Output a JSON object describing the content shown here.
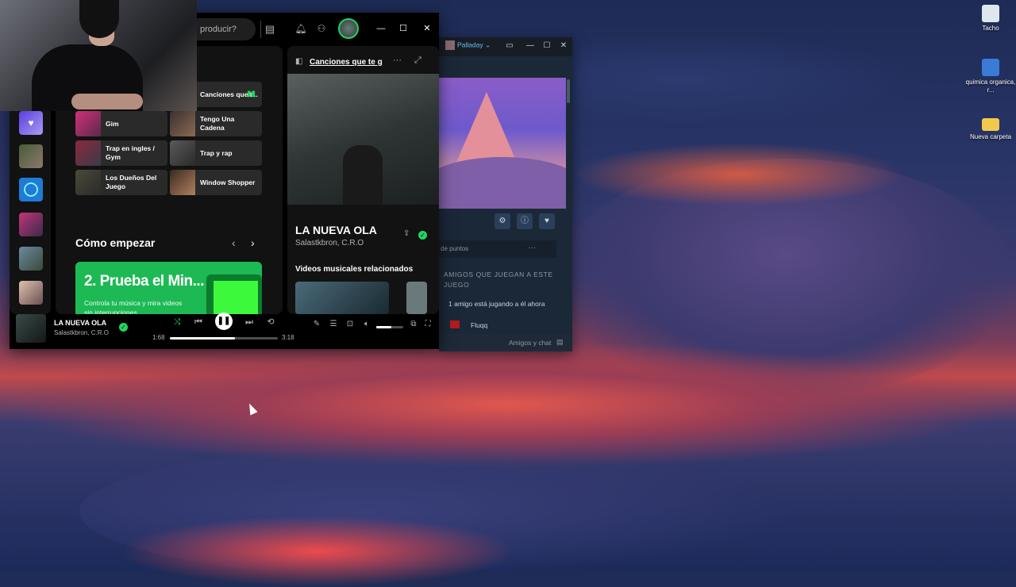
{
  "desktop": {
    "icons": [
      {
        "label": "Tacho",
        "icon": "recycle-bin-icon"
      },
      {
        "label": "quimica organica, r...",
        "icon": "document-icon"
      },
      {
        "label": "Nueva carpeta",
        "icon": "folder-icon"
      }
    ]
  },
  "spotify": {
    "search_placeholder": "producir?",
    "tiles": [
      {
        "label": "Canciones que t...",
        "playing": true
      },
      {
        "label": "Gim"
      },
      {
        "label": "Tengo Una Cadena"
      },
      {
        "label": "Trap en ingles / Gym"
      },
      {
        "label": "Trap y rap"
      },
      {
        "label": "Los Dueños Del Juego"
      },
      {
        "label": "Window Shopper"
      }
    ],
    "section_title": "Cómo empezar",
    "promo": {
      "title": "2. Prueba el Min...",
      "subtitle": "Controla tu música y mira videos sin interrupciones"
    },
    "now_playing_panel": {
      "header": "Canciones que te g",
      "title": "LA NUEVA OLA",
      "artist": "Salastkbron, C.R.O",
      "related": "Videos musicales relacionados"
    },
    "player": {
      "title": "LA NUEVA OLA",
      "artist": "Salastkbron, C.R.O",
      "elapsed": "1:68",
      "duration": "3:18",
      "progress": 0.6,
      "volume": 0.55
    },
    "colors": {
      "accent": "#1ed760",
      "promo": "#1db954"
    }
  },
  "steam": {
    "username": "Palladay",
    "points_label": "de puntos",
    "friends_header": "AMIGOS QUE JUEGAN A ESTE JUEGO",
    "friend_status": "1 amigo está jugando a él ahora",
    "friend_name": "Fluqq",
    "chat_label": "Amigos y chat"
  }
}
